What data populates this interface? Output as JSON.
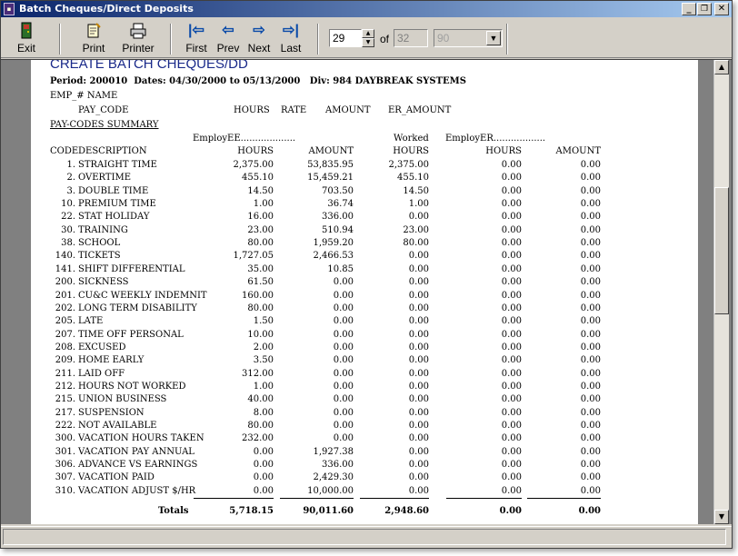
{
  "window": {
    "title": "Batch Cheques/Direct Deposits",
    "minimize_glyph": "_",
    "restore_glyph": "❐",
    "close_glyph": "✕"
  },
  "toolbar": {
    "exit_label": "Exit",
    "print_label": "Print",
    "printer_label": "Printer",
    "first_label": "First",
    "prev_label": "Prev",
    "next_label": "Next",
    "last_label": "Last",
    "current_page": "29",
    "of_label": "of",
    "total_pages": "32",
    "zoom_value": "90"
  },
  "report": {
    "title": "CREATE BATCH CHEQUES/DD",
    "period_line": "Period: 200010  Dates: 04/30/2000 to 05/13/2000   Div: 984 DAYBREAK SYSTEMS",
    "emp_header": "EMP_# NAME",
    "col_headers": {
      "pay_code": "PAY_CODE",
      "hours": "HOURS",
      "rate": "RATE",
      "amount": "AMOUNT",
      "er_amount": "ER_AMOUNT"
    },
    "summary_label": "PAY-CODES SUMMARY",
    "group_headers": {
      "employee": "EmployEE...................",
      "worked": "Worked",
      "employer": "EmployER.................."
    },
    "table_headers": {
      "code": "CODE",
      "description": "DESCRIPTION",
      "ee_hours": "HOURS",
      "ee_amount": "AMOUNT",
      "worked_hours": "HOURS",
      "er_hours": "HOURS",
      "er_amount": "AMOUNT"
    },
    "rows": [
      {
        "code": "1.",
        "desc": "STRAIGHT TIME",
        "ee_hours": "2,375.00",
        "ee_amount": "53,835.95",
        "worked": "2,375.00",
        "er_hours": "0.00",
        "er_amount": "0.00"
      },
      {
        "code": "2.",
        "desc": "OVERTIME",
        "ee_hours": "455.10",
        "ee_amount": "15,459.21",
        "worked": "455.10",
        "er_hours": "0.00",
        "er_amount": "0.00"
      },
      {
        "code": "3.",
        "desc": "DOUBLE TIME",
        "ee_hours": "14.50",
        "ee_amount": "703.50",
        "worked": "14.50",
        "er_hours": "0.00",
        "er_amount": "0.00"
      },
      {
        "code": "10.",
        "desc": "PREMIUM TIME",
        "ee_hours": "1.00",
        "ee_amount": "36.74",
        "worked": "1.00",
        "er_hours": "0.00",
        "er_amount": "0.00"
      },
      {
        "code": "22.",
        "desc": "STAT HOLIDAY",
        "ee_hours": "16.00",
        "ee_amount": "336.00",
        "worked": "0.00",
        "er_hours": "0.00",
        "er_amount": "0.00"
      },
      {
        "code": "30.",
        "desc": "TRAINING",
        "ee_hours": "23.00",
        "ee_amount": "510.94",
        "worked": "23.00",
        "er_hours": "0.00",
        "er_amount": "0.00"
      },
      {
        "code": "38.",
        "desc": "SCHOOL",
        "ee_hours": "80.00",
        "ee_amount": "1,959.20",
        "worked": "80.00",
        "er_hours": "0.00",
        "er_amount": "0.00"
      },
      {
        "code": "140.",
        "desc": "TICKETS",
        "ee_hours": "1,727.05",
        "ee_amount": "2,466.53",
        "worked": "0.00",
        "er_hours": "0.00",
        "er_amount": "0.00"
      },
      {
        "code": "141.",
        "desc": "SHIFT DIFFERENTIAL",
        "ee_hours": "35.00",
        "ee_amount": "10.85",
        "worked": "0.00",
        "er_hours": "0.00",
        "er_amount": "0.00"
      },
      {
        "code": "200.",
        "desc": "SICKNESS",
        "ee_hours": "61.50",
        "ee_amount": "0.00",
        "worked": "0.00",
        "er_hours": "0.00",
        "er_amount": "0.00"
      },
      {
        "code": "201.",
        "desc": "CU&C WEEKLY INDEMNIT",
        "ee_hours": "160.00",
        "ee_amount": "0.00",
        "worked": "0.00",
        "er_hours": "0.00",
        "er_amount": "0.00"
      },
      {
        "code": "202.",
        "desc": "LONG TERM DISABILITY",
        "ee_hours": "80.00",
        "ee_amount": "0.00",
        "worked": "0.00",
        "er_hours": "0.00",
        "er_amount": "0.00"
      },
      {
        "code": "205.",
        "desc": "LATE",
        "ee_hours": "1.50",
        "ee_amount": "0.00",
        "worked": "0.00",
        "er_hours": "0.00",
        "er_amount": "0.00"
      },
      {
        "code": "207.",
        "desc": "TIME OFF PERSONAL",
        "ee_hours": "10.00",
        "ee_amount": "0.00",
        "worked": "0.00",
        "er_hours": "0.00",
        "er_amount": "0.00"
      },
      {
        "code": "208.",
        "desc": "EXCUSED",
        "ee_hours": "2.00",
        "ee_amount": "0.00",
        "worked": "0.00",
        "er_hours": "0.00",
        "er_amount": "0.00"
      },
      {
        "code": "209.",
        "desc": "HOME EARLY",
        "ee_hours": "3.50",
        "ee_amount": "0.00",
        "worked": "0.00",
        "er_hours": "0.00",
        "er_amount": "0.00"
      },
      {
        "code": "211.",
        "desc": "LAID OFF",
        "ee_hours": "312.00",
        "ee_amount": "0.00",
        "worked": "0.00",
        "er_hours": "0.00",
        "er_amount": "0.00"
      },
      {
        "code": "212.",
        "desc": "HOURS NOT WORKED",
        "ee_hours": "1.00",
        "ee_amount": "0.00",
        "worked": "0.00",
        "er_hours": "0.00",
        "er_amount": "0.00"
      },
      {
        "code": "215.",
        "desc": "UNION BUSINESS",
        "ee_hours": "40.00",
        "ee_amount": "0.00",
        "worked": "0.00",
        "er_hours": "0.00",
        "er_amount": "0.00"
      },
      {
        "code": "217.",
        "desc": "SUSPENSION",
        "ee_hours": "8.00",
        "ee_amount": "0.00",
        "worked": "0.00",
        "er_hours": "0.00",
        "er_amount": "0.00"
      },
      {
        "code": "222.",
        "desc": "NOT AVAILABLE",
        "ee_hours": "80.00",
        "ee_amount": "0.00",
        "worked": "0.00",
        "er_hours": "0.00",
        "er_amount": "0.00"
      },
      {
        "code": "300.",
        "desc": "VACATION HOURS TAKEN",
        "ee_hours": "232.00",
        "ee_amount": "0.00",
        "worked": "0.00",
        "er_hours": "0.00",
        "er_amount": "0.00"
      },
      {
        "code": "301.",
        "desc": "VACATION PAY ANNUAL",
        "ee_hours": "0.00",
        "ee_amount": "1,927.38",
        "worked": "0.00",
        "er_hours": "0.00",
        "er_amount": "0.00"
      },
      {
        "code": "306.",
        "desc": "ADVANCE VS EARNINGS",
        "ee_hours": "0.00",
        "ee_amount": "336.00",
        "worked": "0.00",
        "er_hours": "0.00",
        "er_amount": "0.00"
      },
      {
        "code": "307.",
        "desc": "VACATION PAID",
        "ee_hours": "0.00",
        "ee_amount": "2,429.30",
        "worked": "0.00",
        "er_hours": "0.00",
        "er_amount": "0.00"
      },
      {
        "code": "310.",
        "desc": "VACATION ADJUST $/HR",
        "ee_hours": "0.00",
        "ee_amount": "10,000.00",
        "worked": "0.00",
        "er_hours": "0.00",
        "er_amount": "0.00"
      }
    ],
    "totals": {
      "label": "Totals",
      "ee_hours": "5,718.15",
      "ee_amount": "90,011.60",
      "worked": "2,948.60",
      "er_hours": "0.00",
      "er_amount": "0.00"
    }
  }
}
